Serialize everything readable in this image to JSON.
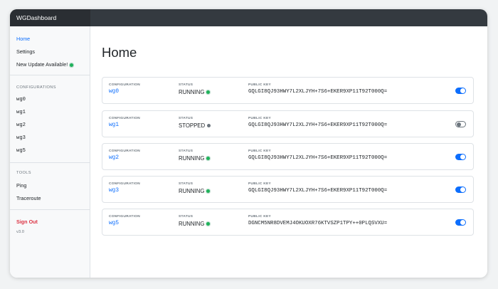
{
  "app": {
    "title": "WGDashboard"
  },
  "sidebar": {
    "home": "Home",
    "settings": "Settings",
    "update": "New Update Available!",
    "configurations_title": "CONFIGURATIONS",
    "configurations": [
      "wg0",
      "wg1",
      "wg2",
      "wg3",
      "wg5"
    ],
    "tools_title": "TOOLS",
    "tools": [
      "Ping",
      "Traceroute"
    ],
    "sign_out": "Sign Out",
    "version": "v3.0"
  },
  "main": {
    "title": "Home",
    "labels": {
      "configuration": "CONFIGURATION",
      "status": "STATUS",
      "public_key": "PUBLIC KEY"
    },
    "configs": [
      {
        "name": "wg0",
        "status": "RUNNING",
        "running": true,
        "key": "GQLGI8QJ93HWY7L2XLJYH+7S6+EKER9XP11T92T000Q="
      },
      {
        "name": "wg1",
        "status": "STOPPED",
        "running": false,
        "key": "GQLGI8QJ93HWY7L2XLJYH+7S6+EKER9XP11T92T000Q="
      },
      {
        "name": "wg2",
        "status": "RUNNING",
        "running": true,
        "key": "GQLGI8QJ93HWY7L2XLJYH+7S6+EKER9XP11T92T000Q="
      },
      {
        "name": "wg3",
        "status": "RUNNING",
        "running": true,
        "key": "GQLGI8QJ93HWY7L2XLJYH+7S6+EKER9XP11T92T000Q="
      },
      {
        "name": "wg5",
        "status": "RUNNING",
        "running": true,
        "key": "DGNCM5NR8DVEMJ4OKUOXR76KTVSZP1TPY++0PLQSVXU="
      }
    ]
  },
  "colors": {
    "running": "#1fb25a",
    "stopped": "#6c757d",
    "accent": "#0d6efd",
    "danger": "#dc3545"
  }
}
